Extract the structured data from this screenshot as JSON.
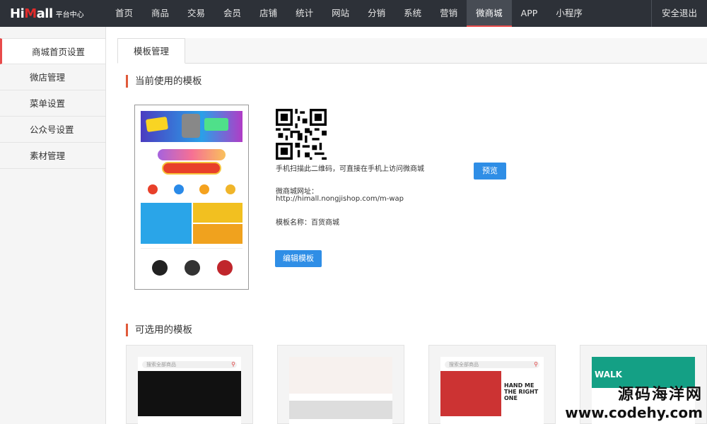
{
  "logo": {
    "brand_main": "Hi",
    "brand_red": "M",
    "brand_rest": "all",
    "subtitle": "平台中心"
  },
  "nav": {
    "items": [
      "首页",
      "商品",
      "交易",
      "会员",
      "店铺",
      "统计",
      "网站",
      "分销",
      "系统",
      "营销",
      "微商城",
      "APP",
      "小程序"
    ],
    "active": "微商城",
    "logout": "安全退出"
  },
  "sidebar": {
    "items": [
      "商城首页设置",
      "微店管理",
      "菜单设置",
      "公众号设置",
      "素材管理"
    ]
  },
  "tabs": {
    "active": "模板管理"
  },
  "current": {
    "title": "当前使用的模板",
    "qr_hint": "手机扫描此二维码，可直接在手机上访问微商城",
    "preview_button": "预览",
    "url_label": "微商城网址：",
    "url_value": "http://himall.nongjishop.com/m-wap",
    "template_name": "模板名称：百货商城",
    "edit_button": "编辑模板"
  },
  "available": {
    "title": "可选用的模板",
    "cards": [
      {
        "search": "搜索全部商品"
      },
      {
        "search": ""
      },
      {
        "search": "搜索全部商品",
        "text": "HAND ME THE RIGHT ONE"
      },
      {
        "search": "",
        "text": "WALK"
      }
    ]
  },
  "watermark": {
    "line1": "源码海洋网",
    "line2": "www.codehy.com"
  },
  "colors": {
    "nav_bg": "#2d3138",
    "accent": "#e84a4a",
    "button": "#2f8ee6"
  }
}
